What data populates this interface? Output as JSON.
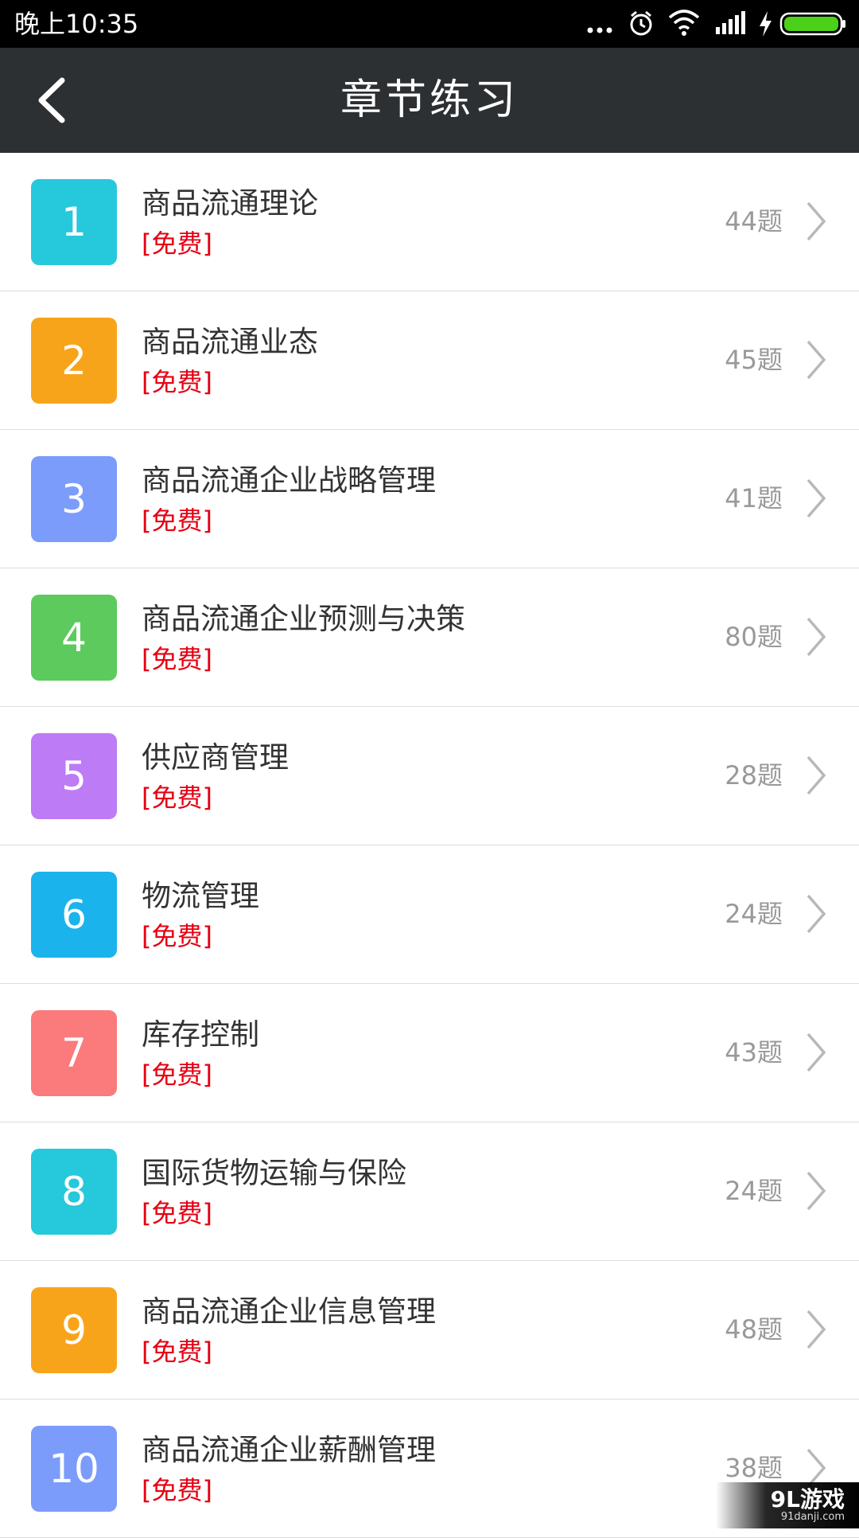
{
  "status_bar": {
    "time": "晚上10:35",
    "icons": [
      "more-icon",
      "alarm-icon",
      "wifi-icon",
      "signal-icon",
      "charging-icon",
      "battery-icon"
    ]
  },
  "app_bar": {
    "title": "章节练习",
    "back_icon": "chevron-left-icon"
  },
  "chapters": [
    {
      "number": "1",
      "name": "商品流通理论",
      "tag": "[免费]",
      "count": "44题",
      "color": "#26c8dc"
    },
    {
      "number": "2",
      "name": "商品流通业态",
      "tag": "[免费]",
      "count": "45题",
      "color": "#f8a41b"
    },
    {
      "number": "3",
      "name": "商品流通企业战略管理",
      "tag": "[免费]",
      "count": "41题",
      "color": "#7b9cfb"
    },
    {
      "number": "4",
      "name": "商品流通企业预测与决策",
      "tag": "[免费]",
      "count": "80题",
      "color": "#5cca5c"
    },
    {
      "number": "5",
      "name": "供应商管理",
      "tag": "[免费]",
      "count": "28题",
      "color": "#bd7bf5"
    },
    {
      "number": "6",
      "name": "物流管理",
      "tag": "[免费]",
      "count": "24题",
      "color": "#1ab3ec"
    },
    {
      "number": "7",
      "name": "库存控制",
      "tag": "[免费]",
      "count": "43题",
      "color": "#fb7a7c"
    },
    {
      "number": "8",
      "name": "国际货物运输与保险",
      "tag": "[免费]",
      "count": "24题",
      "color": "#26c8dc"
    },
    {
      "number": "9",
      "name": "商品流通企业信息管理",
      "tag": "[免费]",
      "count": "48题",
      "color": "#f8a41b"
    },
    {
      "number": "10",
      "name": "商品流通企业薪酬管理",
      "tag": "[免费]",
      "count": "38题",
      "color": "#7b9cfb"
    }
  ],
  "watermark": {
    "logo": "9L游戏",
    "site": "91danji.com"
  }
}
